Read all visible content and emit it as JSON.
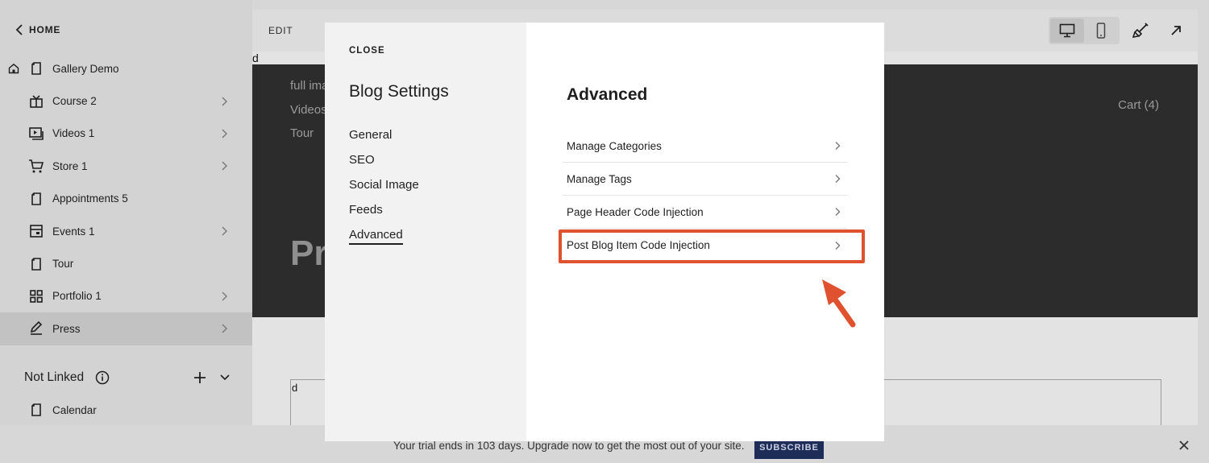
{
  "sidebar": {
    "home_label": "HOME",
    "items": [
      {
        "label": "Gallery Demo",
        "icon": "page-icon",
        "has_chevron": false,
        "is_home": true
      },
      {
        "label": "Course 2",
        "icon": "course-icon",
        "has_chevron": true
      },
      {
        "label": "Videos 1",
        "icon": "video-icon",
        "has_chevron": true
      },
      {
        "label": "Store 1",
        "icon": "cart-icon",
        "has_chevron": true
      },
      {
        "label": "Appointments 5",
        "icon": "page-icon",
        "has_chevron": false
      },
      {
        "label": "Events 1",
        "icon": "calendar-icon",
        "has_chevron": true
      },
      {
        "label": "Tour",
        "icon": "page-icon",
        "has_chevron": false
      },
      {
        "label": "Portfolio 1",
        "icon": "grid-icon",
        "has_chevron": true
      },
      {
        "label": "Press",
        "icon": "blog-icon",
        "has_chevron": true,
        "active": true
      }
    ],
    "not_linked": {
      "title": "Not Linked",
      "items": [
        {
          "label": "Calendar",
          "icon": "page-icon"
        }
      ]
    }
  },
  "editor": {
    "edit_label": "EDIT",
    "center_text": "",
    "stray_char": "d",
    "site_nav": [
      "full ima",
      "Videos",
      "Tour"
    ],
    "cart": "Cart (4)",
    "hero_title": "Pr",
    "box_char": "d"
  },
  "modal": {
    "close_label": "CLOSE",
    "title": "Blog Settings",
    "menu": [
      "General",
      "SEO",
      "Social Image",
      "Feeds",
      "Advanced"
    ],
    "selected_menu": "Advanced",
    "section_title": "Advanced",
    "rows": [
      "Manage Categories",
      "Manage Tags",
      "Page Header Code Injection",
      "Post Blog Item Code Injection"
    ],
    "highlighted_row": "Post Blog Item Code Injection"
  },
  "trial": {
    "message": "Your trial ends in 103 days. Upgrade now to get the most out of your site.",
    "subscribe_label": "SUBSCRIBE"
  },
  "colors": {
    "highlight": "#e0522f",
    "subscribe_bg": "#1e2c58",
    "hero_bg": "#2c2c2c"
  }
}
